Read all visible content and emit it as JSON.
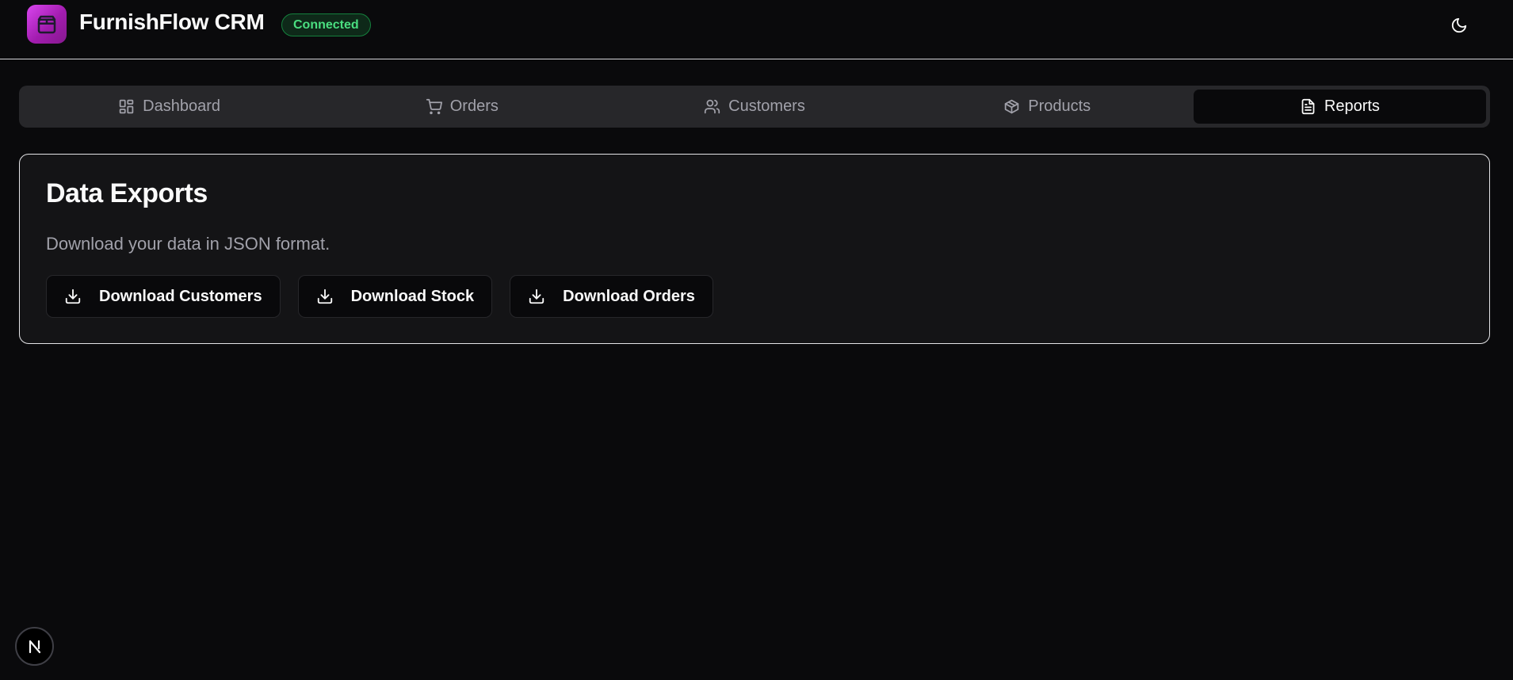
{
  "header": {
    "app_title": "FurnishFlow CRM",
    "status_badge": "Connected",
    "logo_icon": "package-icon",
    "theme_toggle_icon": "moon-icon"
  },
  "tabs": [
    {
      "label": "Dashboard",
      "icon": "dashboard-icon",
      "active": false
    },
    {
      "label": "Orders",
      "icon": "cart-icon",
      "active": false
    },
    {
      "label": "Customers",
      "icon": "users-icon",
      "active": false
    },
    {
      "label": "Products",
      "icon": "box-icon",
      "active": false
    },
    {
      "label": "Reports",
      "icon": "file-text-icon",
      "active": true
    }
  ],
  "exports_card": {
    "title": "Data Exports",
    "description": "Download your data in JSON format.",
    "buttons": [
      {
        "label": "Download Customers",
        "icon": "download-icon"
      },
      {
        "label": "Download Stock",
        "icon": "download-icon"
      },
      {
        "label": "Download Orders",
        "icon": "download-icon"
      }
    ]
  },
  "dev_badge": {
    "label": "N"
  },
  "colors": {
    "background": "#0a0a0c",
    "accent_start": "#d946ef",
    "accent_end": "#86198f",
    "status_green": "#4ade80",
    "tab_bar": "#27272a",
    "card_bg": "#141416",
    "muted_text": "#a1a1aa"
  }
}
